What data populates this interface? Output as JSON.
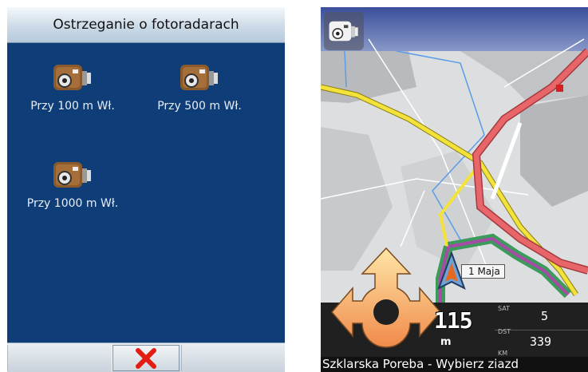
{
  "settings_screen": {
    "title": "Ostrzeganie o fotoradarach",
    "options": [
      {
        "label": "Przy 100 m Wł.",
        "icon": "speed-camera-icon"
      },
      {
        "label": "Przy 500 m Wł.",
        "icon": "speed-camera-icon"
      },
      {
        "label": "Przy 1000 m Wł.",
        "icon": "speed-camera-icon"
      }
    ],
    "bottom_bar": {
      "cancel_icon": "close-icon",
      "cancel_color": "#e31d12"
    },
    "colors": {
      "background": "#0e3d78",
      "text": "#e8eef6"
    }
  },
  "navigation_screen": {
    "street_label": "1 Maja",
    "distance_value": "115",
    "distance_unit": "m",
    "stats": {
      "sat_label": "SAT",
      "sat_value": "5",
      "dst_label": "DST",
      "dst_value": "339",
      "km_label": "KM"
    },
    "status_text": "Szklarska Poreba - Wybierz ziazd",
    "camera_badge_icon": "speed-camera-icon",
    "turn_icon": "roundabout-turn-icon",
    "position_icon": "nav-arrow-icon",
    "colors": {
      "route": "#a64ca6",
      "main_road": "#e8666a",
      "secondary_road": "#f2e23a"
    }
  }
}
